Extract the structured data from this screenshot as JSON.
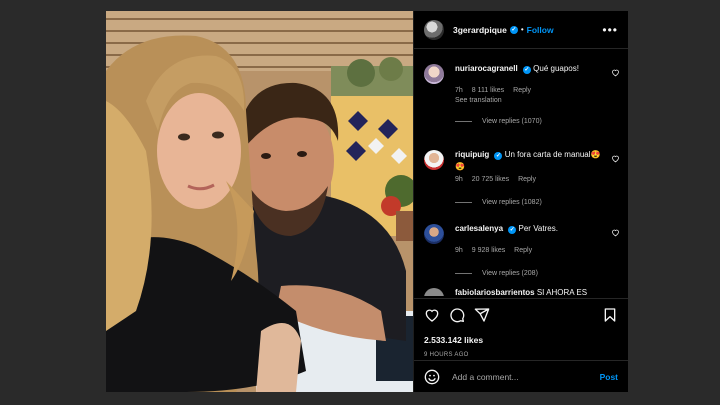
{
  "post": {
    "username": "3gerardpique",
    "follow_label": "Follow",
    "more_label": "•••",
    "likes": "2.533.142 likes",
    "time": "9 HOURS AGO"
  },
  "comments": [
    {
      "username": "nuriarocagranell",
      "text": "Qué guapos!",
      "age": "7h",
      "likes": "8 111 likes",
      "reply_label": "Reply",
      "see_translation": "See translation",
      "view_replies": "View replies (1070)"
    },
    {
      "username": "riquipuig",
      "text": "Un fora carta de manual😍😍",
      "age": "9h",
      "likes": "20 725 likes",
      "reply_label": "Reply",
      "view_replies": "View replies (1082)"
    },
    {
      "username": "carlesalenya",
      "text": "Per Vatres.",
      "age": "9h",
      "likes": "9 928 likes",
      "reply_label": "Reply",
      "view_replies": "View replies (208)"
    },
    {
      "username": "fabiolariosbarrientos",
      "text": "SI AHORA ES"
    }
  ],
  "comment_box": {
    "placeholder": "Add a comment...",
    "post_label": "Post"
  },
  "icons": {
    "header": [
      "avatar",
      "verified-badge",
      "more-icon"
    ],
    "actions": [
      "heart-icon",
      "comment-icon",
      "share-icon",
      "bookmark-icon"
    ],
    "composer": [
      "emoji-icon"
    ]
  },
  "colors": {
    "accent": "#0095f6",
    "background": "#000000",
    "secondary_text": "#a8a8a8"
  }
}
